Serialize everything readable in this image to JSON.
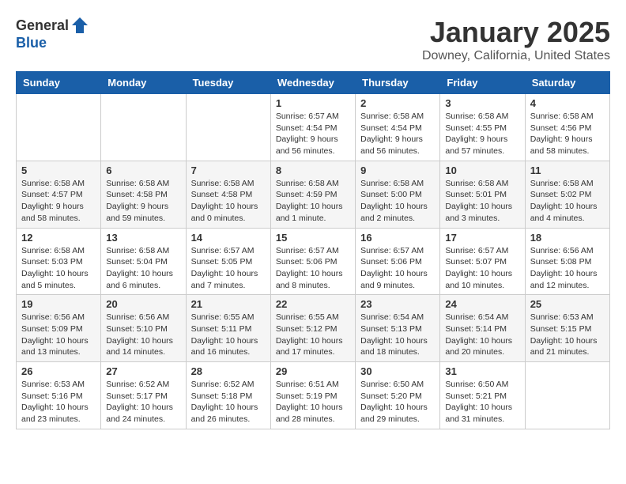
{
  "header": {
    "logo_general": "General",
    "logo_blue": "Blue",
    "month_title": "January 2025",
    "location": "Downey, California, United States"
  },
  "weekdays": [
    "Sunday",
    "Monday",
    "Tuesday",
    "Wednesday",
    "Thursday",
    "Friday",
    "Saturday"
  ],
  "weeks": [
    [
      {
        "day": "",
        "info": ""
      },
      {
        "day": "",
        "info": ""
      },
      {
        "day": "",
        "info": ""
      },
      {
        "day": "1",
        "info": "Sunrise: 6:57 AM\nSunset: 4:54 PM\nDaylight: 9 hours\nand 56 minutes."
      },
      {
        "day": "2",
        "info": "Sunrise: 6:58 AM\nSunset: 4:54 PM\nDaylight: 9 hours\nand 56 minutes."
      },
      {
        "day": "3",
        "info": "Sunrise: 6:58 AM\nSunset: 4:55 PM\nDaylight: 9 hours\nand 57 minutes."
      },
      {
        "day": "4",
        "info": "Sunrise: 6:58 AM\nSunset: 4:56 PM\nDaylight: 9 hours\nand 58 minutes."
      }
    ],
    [
      {
        "day": "5",
        "info": "Sunrise: 6:58 AM\nSunset: 4:57 PM\nDaylight: 9 hours\nand 58 minutes."
      },
      {
        "day": "6",
        "info": "Sunrise: 6:58 AM\nSunset: 4:58 PM\nDaylight: 9 hours\nand 59 minutes."
      },
      {
        "day": "7",
        "info": "Sunrise: 6:58 AM\nSunset: 4:58 PM\nDaylight: 10 hours\nand 0 minutes."
      },
      {
        "day": "8",
        "info": "Sunrise: 6:58 AM\nSunset: 4:59 PM\nDaylight: 10 hours\nand 1 minute."
      },
      {
        "day": "9",
        "info": "Sunrise: 6:58 AM\nSunset: 5:00 PM\nDaylight: 10 hours\nand 2 minutes."
      },
      {
        "day": "10",
        "info": "Sunrise: 6:58 AM\nSunset: 5:01 PM\nDaylight: 10 hours\nand 3 minutes."
      },
      {
        "day": "11",
        "info": "Sunrise: 6:58 AM\nSunset: 5:02 PM\nDaylight: 10 hours\nand 4 minutes."
      }
    ],
    [
      {
        "day": "12",
        "info": "Sunrise: 6:58 AM\nSunset: 5:03 PM\nDaylight: 10 hours\nand 5 minutes."
      },
      {
        "day": "13",
        "info": "Sunrise: 6:58 AM\nSunset: 5:04 PM\nDaylight: 10 hours\nand 6 minutes."
      },
      {
        "day": "14",
        "info": "Sunrise: 6:57 AM\nSunset: 5:05 PM\nDaylight: 10 hours\nand 7 minutes."
      },
      {
        "day": "15",
        "info": "Sunrise: 6:57 AM\nSunset: 5:06 PM\nDaylight: 10 hours\nand 8 minutes."
      },
      {
        "day": "16",
        "info": "Sunrise: 6:57 AM\nSunset: 5:06 PM\nDaylight: 10 hours\nand 9 minutes."
      },
      {
        "day": "17",
        "info": "Sunrise: 6:57 AM\nSunset: 5:07 PM\nDaylight: 10 hours\nand 10 minutes."
      },
      {
        "day": "18",
        "info": "Sunrise: 6:56 AM\nSunset: 5:08 PM\nDaylight: 10 hours\nand 12 minutes."
      }
    ],
    [
      {
        "day": "19",
        "info": "Sunrise: 6:56 AM\nSunset: 5:09 PM\nDaylight: 10 hours\nand 13 minutes."
      },
      {
        "day": "20",
        "info": "Sunrise: 6:56 AM\nSunset: 5:10 PM\nDaylight: 10 hours\nand 14 minutes."
      },
      {
        "day": "21",
        "info": "Sunrise: 6:55 AM\nSunset: 5:11 PM\nDaylight: 10 hours\nand 16 minutes."
      },
      {
        "day": "22",
        "info": "Sunrise: 6:55 AM\nSunset: 5:12 PM\nDaylight: 10 hours\nand 17 minutes."
      },
      {
        "day": "23",
        "info": "Sunrise: 6:54 AM\nSunset: 5:13 PM\nDaylight: 10 hours\nand 18 minutes."
      },
      {
        "day": "24",
        "info": "Sunrise: 6:54 AM\nSunset: 5:14 PM\nDaylight: 10 hours\nand 20 minutes."
      },
      {
        "day": "25",
        "info": "Sunrise: 6:53 AM\nSunset: 5:15 PM\nDaylight: 10 hours\nand 21 minutes."
      }
    ],
    [
      {
        "day": "26",
        "info": "Sunrise: 6:53 AM\nSunset: 5:16 PM\nDaylight: 10 hours\nand 23 minutes."
      },
      {
        "day": "27",
        "info": "Sunrise: 6:52 AM\nSunset: 5:17 PM\nDaylight: 10 hours\nand 24 minutes."
      },
      {
        "day": "28",
        "info": "Sunrise: 6:52 AM\nSunset: 5:18 PM\nDaylight: 10 hours\nand 26 minutes."
      },
      {
        "day": "29",
        "info": "Sunrise: 6:51 AM\nSunset: 5:19 PM\nDaylight: 10 hours\nand 28 minutes."
      },
      {
        "day": "30",
        "info": "Sunrise: 6:50 AM\nSunset: 5:20 PM\nDaylight: 10 hours\nand 29 minutes."
      },
      {
        "day": "31",
        "info": "Sunrise: 6:50 AM\nSunset: 5:21 PM\nDaylight: 10 hours\nand 31 minutes."
      },
      {
        "day": "",
        "info": ""
      }
    ]
  ]
}
